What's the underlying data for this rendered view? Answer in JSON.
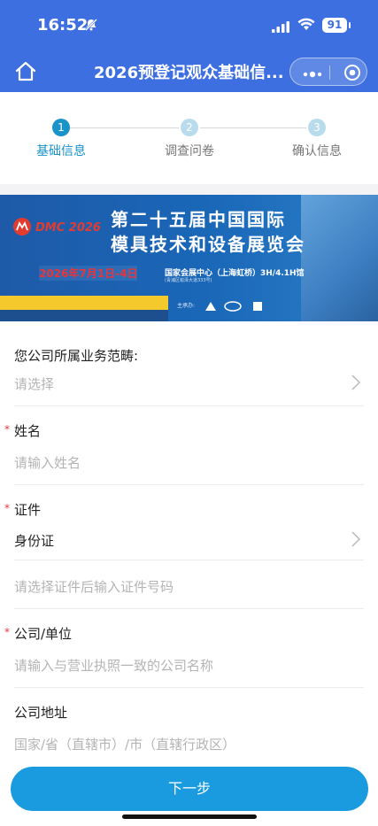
{
  "status": {
    "time": "16:52",
    "battery": "91"
  },
  "nav": {
    "title": "2026预登记观众基础信..."
  },
  "steps": [
    {
      "num": "1",
      "label": "基础信息"
    },
    {
      "num": "2",
      "label": "调查问卷"
    },
    {
      "num": "3",
      "label": "确认信息"
    }
  ],
  "banner": {
    "logo": "DMC 2026",
    "title_line1": "第二十五届中国国际",
    "title_line2": "模具技术和设备展览会",
    "date": "2026年7月1日-4日",
    "venue": "国家会展中心（上海虹桥）3H/4.1H馆",
    "address": "(青浦区崧泽大道333号)",
    "host": "主承办:"
  },
  "form": {
    "business_scope": {
      "label": "您公司所属业务范畴:",
      "placeholder": "请选择"
    },
    "name": {
      "label": "姓名",
      "placeholder": "请输入姓名"
    },
    "id_doc": {
      "label": "证件",
      "value": "身份证",
      "number_placeholder": "请选择证件后输入证件号码"
    },
    "company": {
      "label": "公司/单位",
      "placeholder": "请输入与营业执照一致的公司名称"
    },
    "address": {
      "label": "公司地址",
      "placeholder": "国家/省（直辖市）/市（直辖行政区）"
    }
  },
  "buttons": {
    "next": "下一步"
  },
  "colors": {
    "header": "#3e6fe0",
    "accent": "#1a93c9",
    "button": "#1a9be0",
    "required": "#e4393c"
  }
}
